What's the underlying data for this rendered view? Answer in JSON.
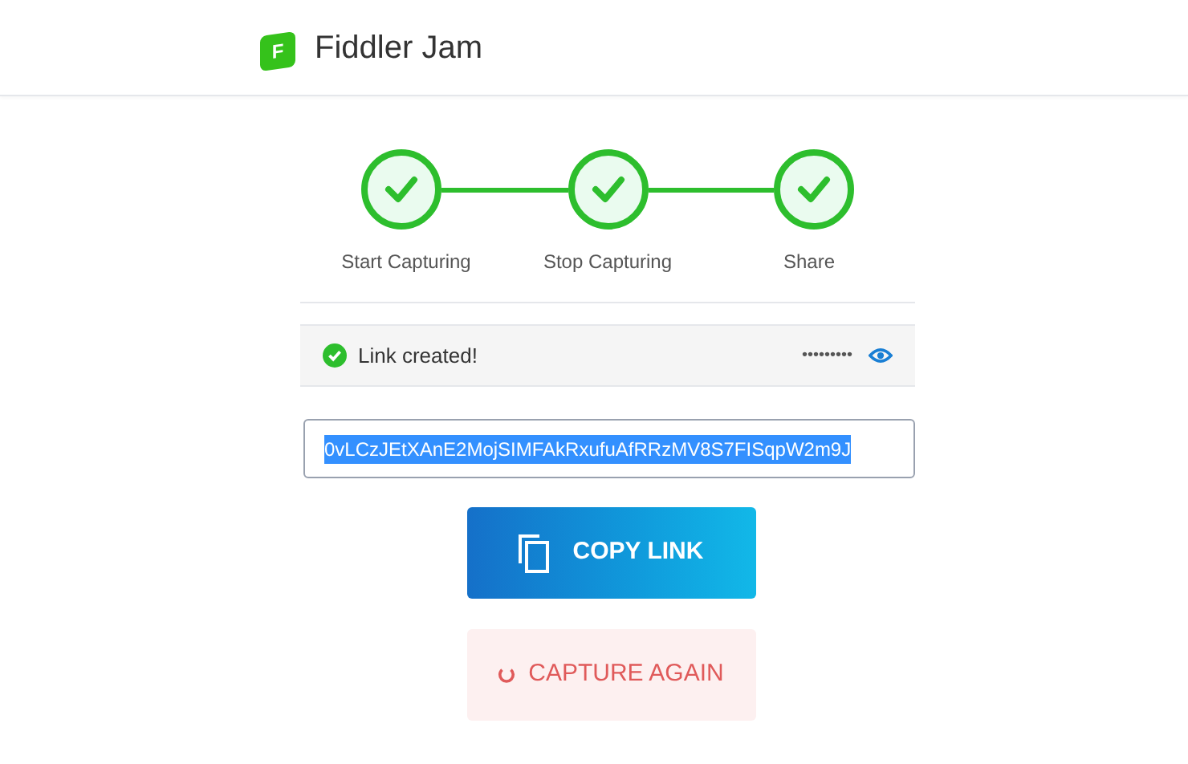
{
  "header": {
    "title": "Fiddler Jam",
    "logo_letter": "F"
  },
  "steps": [
    {
      "label": "Start Capturing",
      "done": true
    },
    {
      "label": "Stop Capturing",
      "done": true
    },
    {
      "label": "Share",
      "done": true
    }
  ],
  "status": {
    "message": "Link created!",
    "password": "•••••••••"
  },
  "link_field": {
    "value": "0vLCzJEtXAnE2MojSIMFAkRxufuAfRRzMV8S7FISqpW2m9J",
    "selected": true
  },
  "buttons": [
    {
      "kind": "primary",
      "label": "COPY LINK"
    },
    {
      "kind": "danger",
      "label": "CAPTURE AGAIN"
    }
  ]
}
